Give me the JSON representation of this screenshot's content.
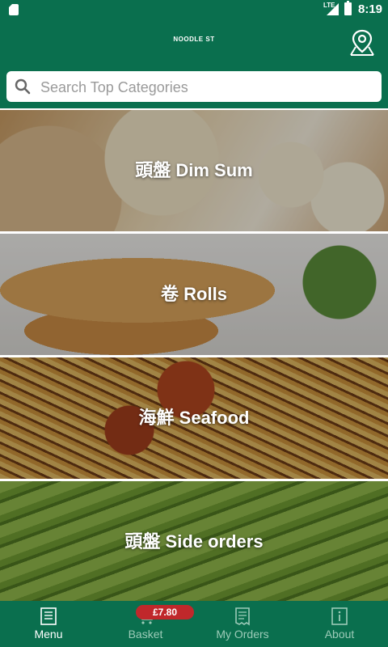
{
  "status_bar": {
    "network": "LTE",
    "time": "8:19"
  },
  "app_bar": {
    "logo_text": "NOODLE ST"
  },
  "search": {
    "placeholder": "Search Top Categories"
  },
  "categories": [
    {
      "label": "頭盤 Dim Sum"
    },
    {
      "label": "卷 Rolls"
    },
    {
      "label": "海鮮 Seafood"
    },
    {
      "label": "頭盤 Side orders"
    }
  ],
  "bottom_nav": {
    "tabs": [
      {
        "label": "Menu",
        "icon": "menu-book-icon",
        "active": true
      },
      {
        "label": "Basket",
        "icon": "basket-icon",
        "active": false
      },
      {
        "label": "My Orders",
        "icon": "receipt-icon",
        "active": false
      },
      {
        "label": "About",
        "icon": "info-icon",
        "active": false
      }
    ],
    "basket_badge": "£7.80"
  },
  "colors": {
    "brand": "#0a6f4e",
    "badge": "#c0282b",
    "inactive_tab": "#9ccbb8"
  }
}
